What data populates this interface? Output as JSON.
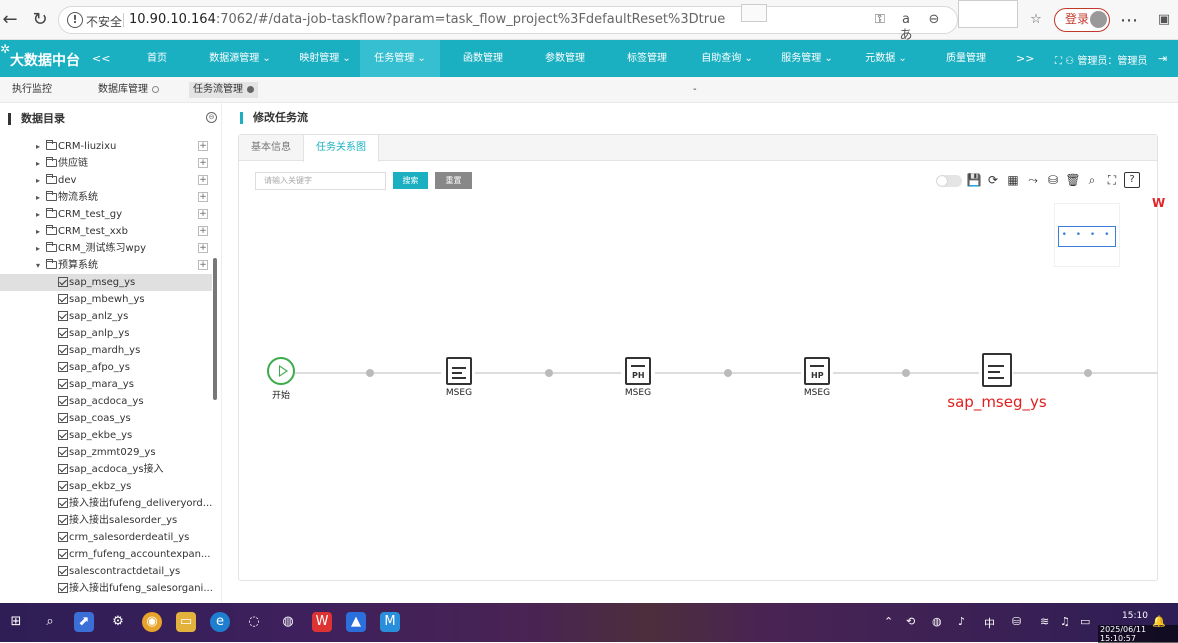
{
  "browser": {
    "insecure_label": "不安全",
    "url_host": "10.90.10.164",
    "url_rest": ":7062/#/data-job-taskflow?param=task_flow_project%3FdefaultReset%3Dtrue",
    "login_label": "登录"
  },
  "app": {
    "logo": "大数据中台",
    "collapse": "<<",
    "more": ">>",
    "nav": [
      {
        "label": "首页"
      },
      {
        "label": "数据源管理 ⌄"
      },
      {
        "label": "映射管理 ⌄"
      },
      {
        "label": "任务管理 ⌄"
      },
      {
        "label": "函数管理"
      },
      {
        "label": "参数管理"
      },
      {
        "label": "标签管理"
      },
      {
        "label": "自助查询 ⌄"
      },
      {
        "label": "服务管理 ⌄"
      },
      {
        "label": "元数据 ⌄"
      },
      {
        "label": "质量管理"
      }
    ],
    "user": "管理员：管理员"
  },
  "tabs": [
    {
      "label": "执行监控"
    },
    {
      "label": "数据库管理"
    },
    {
      "label": "任务流管理"
    }
  ],
  "tab_dash": "-",
  "sidebar": {
    "title": "数据目录",
    "folders": [
      {
        "label": "CRM-liuzixu"
      },
      {
        "label": "供应链"
      },
      {
        "label": "dev"
      },
      {
        "label": "物流系统"
      },
      {
        "label": "CRM_test_gy"
      },
      {
        "label": "CRM_test_xxb"
      },
      {
        "label": "CRM_测试练习wpy"
      },
      {
        "label": "预算系统"
      }
    ],
    "leaves": [
      {
        "label": "sap_mseg_ys"
      },
      {
        "label": "sap_mbewh_ys"
      },
      {
        "label": "sap_anlz_ys"
      },
      {
        "label": "sap_anlp_ys"
      },
      {
        "label": "sap_mardh_ys"
      },
      {
        "label": "sap_afpo_ys"
      },
      {
        "label": "sap_mara_ys"
      },
      {
        "label": "sap_acdoca_ys"
      },
      {
        "label": "sap_coas_ys"
      },
      {
        "label": "sap_ekbe_ys"
      },
      {
        "label": "sap_zmmt029_ys"
      },
      {
        "label": "sap_acdoca_ys接入"
      },
      {
        "label": "sap_ekbz_ys"
      },
      {
        "label": "接入接出fufeng_deliveryord..."
      },
      {
        "label": "接入接出salesorder_ys"
      },
      {
        "label": "crm_salesorderdeatil_ys"
      },
      {
        "label": "crm_fufeng_accountexpan..."
      },
      {
        "label": "salescontractdetail_ys"
      },
      {
        "label": "接入接出fufeng_salesorgani..."
      }
    ]
  },
  "main": {
    "title": "修改任务流",
    "tabs": [
      {
        "label": "基本信息"
      },
      {
        "label": "任务关系图"
      }
    ],
    "search_placeholder": "请输入关键字",
    "search_btn": "搜索",
    "reset_btn": "重置",
    "minimap_dots": "• • • •"
  },
  "flow": {
    "nodes": [
      {
        "label": "开始"
      },
      {
        "label": "MSEG",
        "tag": ""
      },
      {
        "label": "MSEG",
        "tag": "PH"
      },
      {
        "label": "MSEG",
        "tag": "HP"
      },
      {
        "label": "sap_mseg_ys"
      }
    ]
  },
  "taskbar": {
    "ime": "中",
    "time": "15:10",
    "stamp": "2025/06/11 15:10:57"
  }
}
